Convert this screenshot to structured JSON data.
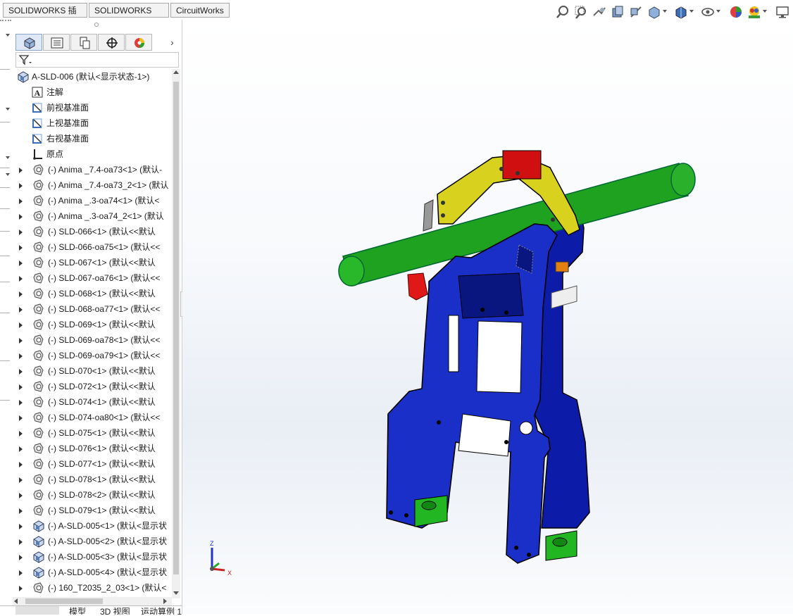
{
  "command_tabs": [
    "SOLIDWORKS 插件",
    "SOLIDWORKS MBD",
    "CircuitWorks"
  ],
  "feature_tree": {
    "root": "A-SLD-006  (默认<显示状态-1>)",
    "items": [
      {
        "label": "注解",
        "icon": "annotation-icon",
        "expandable": false
      },
      {
        "label": "前视基准面",
        "icon": "plane-icon",
        "expandable": false
      },
      {
        "label": "上视基准面",
        "icon": "plane-icon",
        "expandable": false
      },
      {
        "label": "右视基准面",
        "icon": "plane-icon",
        "expandable": false
      },
      {
        "label": "原点",
        "icon": "origin-icon",
        "expandable": false
      },
      {
        "label": "(-) Anima _7.4-oa73<1> (默认-",
        "icon": "part-icon",
        "expandable": true
      },
      {
        "label": "(-) Anima _7.4-oa73_2<1> (默认",
        "icon": "part-icon",
        "expandable": true
      },
      {
        "label": "(-) Anima _.3-oa74<1> (默认<",
        "icon": "part-icon",
        "expandable": true
      },
      {
        "label": "(-) Anima _.3-oa74_2<1> (默认",
        "icon": "part-icon",
        "expandable": true
      },
      {
        "label": "(-) SLD-066<1> (默认<<默认",
        "icon": "part-icon",
        "expandable": true
      },
      {
        "label": "(-) SLD-066-oa75<1> (默认<<",
        "icon": "part-icon",
        "expandable": true
      },
      {
        "label": "(-) SLD-067<1> (默认<<默认",
        "icon": "part-icon",
        "expandable": true
      },
      {
        "label": "(-) SLD-067-oa76<1> (默认<<",
        "icon": "part-icon",
        "expandable": true
      },
      {
        "label": "(-) SLD-068<1> (默认<<默认",
        "icon": "part-icon",
        "expandable": true
      },
      {
        "label": "(-) SLD-068-oa77<1> (默认<<",
        "icon": "part-icon",
        "expandable": true
      },
      {
        "label": "(-) SLD-069<1> (默认<<默认",
        "icon": "part-icon",
        "expandable": true
      },
      {
        "label": "(-) SLD-069-oa78<1> (默认<<",
        "icon": "part-icon",
        "expandable": true
      },
      {
        "label": "(-) SLD-069-oa79<1> (默认<<",
        "icon": "part-icon",
        "expandable": true
      },
      {
        "label": "(-) SLD-070<1> (默认<<默认",
        "icon": "part-icon",
        "expandable": true
      },
      {
        "label": "(-) SLD-072<1> (默认<<默认",
        "icon": "part-icon",
        "expandable": true
      },
      {
        "label": "(-) SLD-074<1> (默认<<默认",
        "icon": "part-icon",
        "expandable": true
      },
      {
        "label": "(-) SLD-074-oa80<1> (默认<<",
        "icon": "part-icon",
        "expandable": true
      },
      {
        "label": "(-) SLD-075<1> (默认<<默认",
        "icon": "part-icon",
        "expandable": true
      },
      {
        "label": "(-) SLD-076<1> (默认<<默认",
        "icon": "part-icon",
        "expandable": true
      },
      {
        "label": "(-) SLD-077<1> (默认<<默认",
        "icon": "part-icon",
        "expandable": true
      },
      {
        "label": "(-) SLD-078<1> (默认<<默认",
        "icon": "part-icon",
        "expandable": true
      },
      {
        "label": "(-) SLD-078<2> (默认<<默认",
        "icon": "part-icon",
        "expandable": true
      },
      {
        "label": "(-) SLD-079<1> (默认<<默认",
        "icon": "part-icon",
        "expandable": true
      },
      {
        "label": "(-) A-SLD-005<1> (默认<显示状",
        "icon": "assembly-icon",
        "expandable": true
      },
      {
        "label": "(-) A-SLD-005<2> (默认<显示状",
        "icon": "assembly-icon",
        "expandable": true
      },
      {
        "label": "(-) A-SLD-005<3> (默认<显示状",
        "icon": "assembly-icon",
        "expandable": true
      },
      {
        "label": "(-) A-SLD-005<4> (默认<显示状",
        "icon": "assembly-icon",
        "expandable": true
      },
      {
        "label": "(-) 160_T2035_2_03<1> (默认<",
        "icon": "part-icon",
        "expandable": true
      }
    ]
  },
  "bottom_tabs": [
    "模型",
    "3D 视图",
    "运动算例 1"
  ],
  "triad": {
    "z": "Z",
    "x": "X"
  },
  "colors": {
    "frame": "#1a2fc8",
    "tube": "#1ea01e",
    "clamp": "#d6d020",
    "accent_red": "#d01010"
  }
}
